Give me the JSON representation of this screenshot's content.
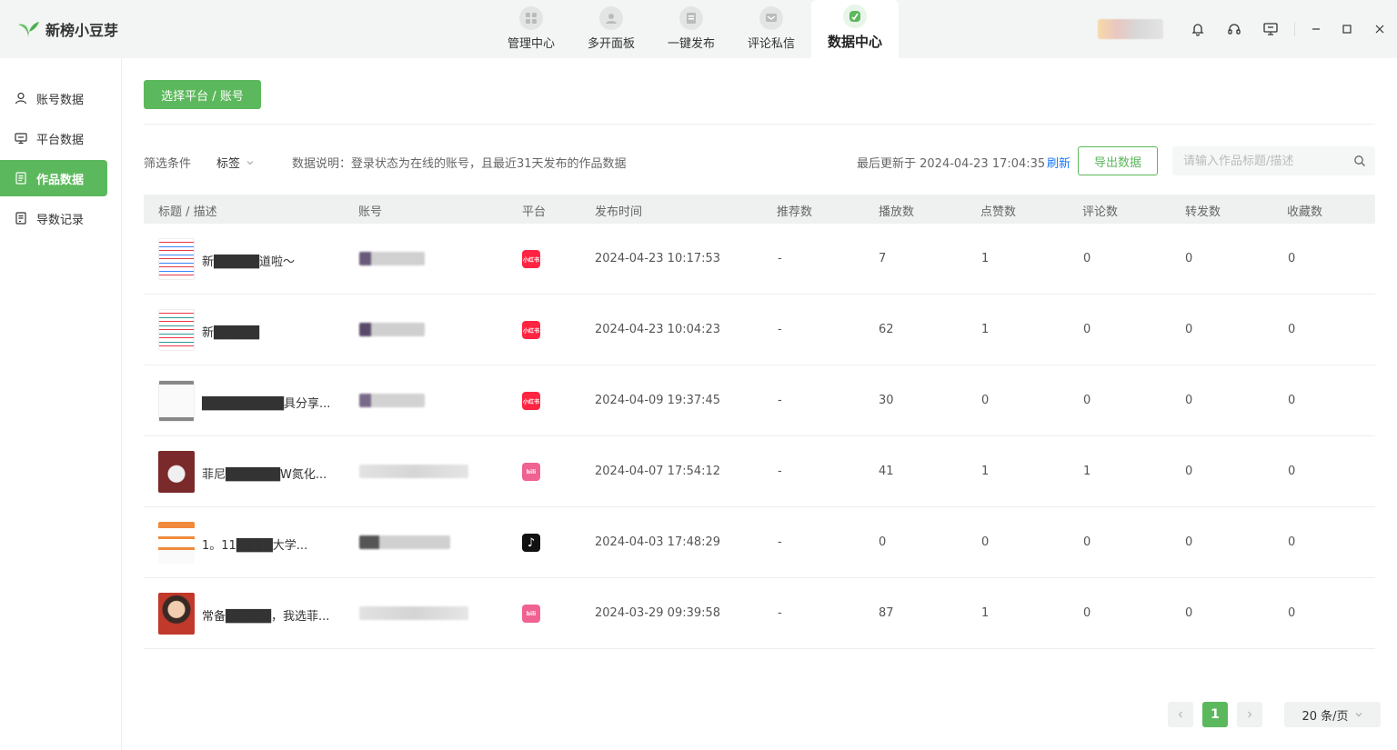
{
  "app": {
    "name": "新榜小豆芽",
    "brand_color": "#5cb85c"
  },
  "nav": [
    {
      "label": "管理中心",
      "icon": "grid-icon",
      "active": false
    },
    {
      "label": "多开面板",
      "icon": "user-icon",
      "active": false
    },
    {
      "label": "一键发布",
      "icon": "publish-icon",
      "active": false
    },
    {
      "label": "评论私信",
      "icon": "message-icon",
      "active": false
    },
    {
      "label": "数据中心",
      "icon": "data-center-icon",
      "active": true
    }
  ],
  "sidebar": {
    "items": [
      {
        "label": "账号数据",
        "icon": "user-icon",
        "active": false
      },
      {
        "label": "平台数据",
        "icon": "monitor-icon",
        "active": false
      },
      {
        "label": "作品数据",
        "icon": "document-icon",
        "active": true
      },
      {
        "label": "导数记录",
        "icon": "record-icon",
        "active": false
      }
    ]
  },
  "toolbar": {
    "select_label": "选择平台 / 账号",
    "filter_label": "筛选条件",
    "tag_label": "标签",
    "description": "数据说明：登录状态为在线的账号，且最近31天发布的作品数据",
    "last_updated": "最后更新于 2024-04-23 17:04:35",
    "refresh_label": "刷新",
    "export_label": "导出数据",
    "search_placeholder": "请输入作品标题/描述"
  },
  "table": {
    "headers": [
      "标题 / 描述",
      "账号",
      "平台",
      "发布时间",
      "推荐数",
      "播放数",
      "点赞数",
      "评论数",
      "转发数",
      "收藏数"
    ],
    "rows": [
      {
        "title": "新█████道啦～",
        "platform": "小红书",
        "time": "2024-04-23 10:17:53",
        "rec": "-",
        "play": "7",
        "like": "1",
        "comment": "0",
        "share": "0",
        "fav": "0"
      },
      {
        "title": "新█████",
        "platform": "小红书",
        "time": "2024-04-23 10:04:23",
        "rec": "-",
        "play": "62",
        "like": "1",
        "comment": "0",
        "share": "0",
        "fav": "0"
      },
      {
        "title": "█████████具分享...",
        "platform": "小红书",
        "time": "2024-04-09 19:37:45",
        "rec": "-",
        "play": "30",
        "like": "0",
        "comment": "0",
        "share": "0",
        "fav": "0"
      },
      {
        "title": "菲尼██████W氮化...",
        "platform": "哔哩哔哩",
        "time": "2024-04-07 17:54:12",
        "rec": "-",
        "play": "41",
        "like": "1",
        "comment": "1",
        "share": "0",
        "fav": "0"
      },
      {
        "title": "1。11████大学...",
        "platform": "抖音",
        "time": "2024-04-03 17:48:29",
        "rec": "-",
        "play": "0",
        "like": "0",
        "comment": "0",
        "share": "0",
        "fav": "0"
      },
      {
        "title": "常备█████，我选菲...",
        "platform": "哔哩哔哩",
        "time": "2024-03-29 09:39:58",
        "rec": "-",
        "play": "87",
        "like": "1",
        "comment": "0",
        "share": "0",
        "fav": "0"
      }
    ]
  },
  "pagination": {
    "current": "1",
    "page_size": "20 条/页"
  }
}
